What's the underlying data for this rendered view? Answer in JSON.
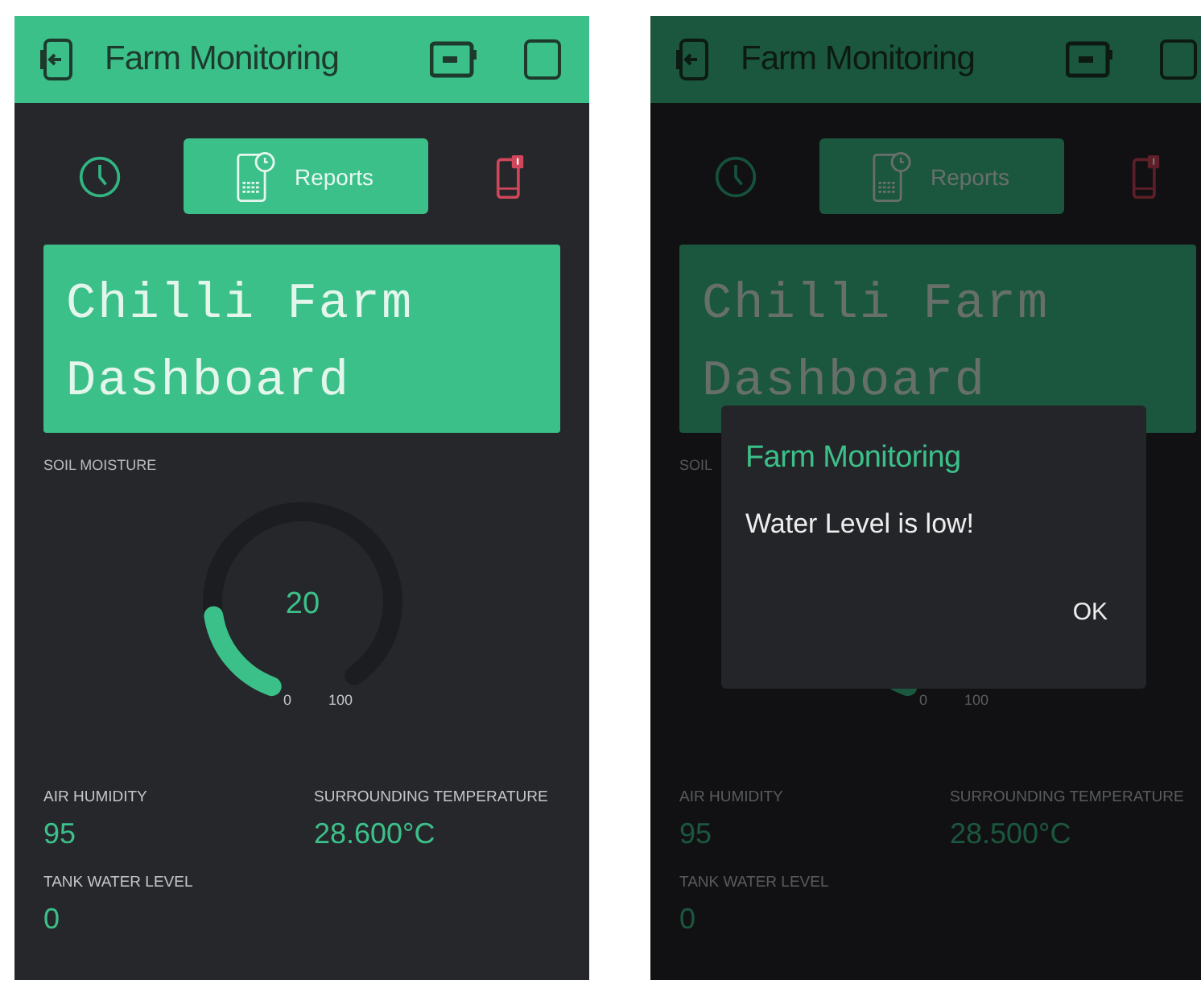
{
  "screens": [
    {
      "dimmed": false,
      "app_bar": {
        "title": "Farm Monitoring"
      },
      "tabs": [
        {
          "kind": "clock",
          "selected": false
        },
        {
          "kind": "reports",
          "label": "Reports",
          "selected": true
        },
        {
          "kind": "alert",
          "selected": false
        }
      ],
      "display": {
        "lines": [
          "Chilli Farm",
          "Dashboard"
        ]
      },
      "gauge": {
        "label": "SOIL MOISTURE",
        "value": "20",
        "level": 0.2,
        "min": "0",
        "max": "100"
      },
      "readings": [
        {
          "label": "AIR HUMIDITY",
          "value": "95"
        },
        {
          "label": "SURROUNDING TEMPERATURE",
          "value": "28.600°C"
        },
        {
          "label": "TANK WATER LEVEL",
          "value": "0"
        }
      ]
    },
    {
      "dimmed": true,
      "app_bar": {
        "title": "Farm Monitoring"
      },
      "tabs": [
        {
          "kind": "clock",
          "selected": false
        },
        {
          "kind": "reports",
          "label": "Reports",
          "selected": true
        },
        {
          "kind": "alert",
          "selected": false
        }
      ],
      "display": {
        "lines": [
          "Chilli Farm",
          "Dashboard"
        ]
      },
      "gauge": {
        "label": "SOIL",
        "level": 0.2,
        "min": "0",
        "max": "100"
      },
      "readings": [
        {
          "label": "AIR HUMIDITY",
          "value": "95"
        },
        {
          "label": "SURROUNDING TEMPERATURE",
          "value": "28.500°C"
        },
        {
          "label": "TANK WATER LEVEL",
          "value": "0"
        }
      ],
      "dialog": {
        "title": "Farm Monitoring",
        "message": "Water Level is low!",
        "button": "OK"
      }
    }
  ]
}
